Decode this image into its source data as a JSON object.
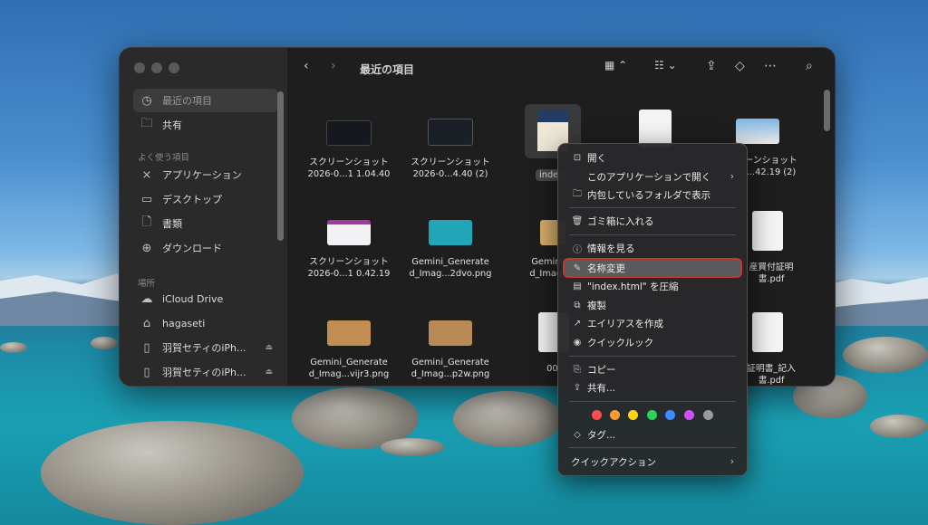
{
  "window": {
    "title": "最近の項目"
  },
  "sidebar": {
    "recents": "最近の項目",
    "shared": "共有",
    "favorites_header": "よく使う項目",
    "favorites": [
      "アプリケーション",
      "デスクトップ",
      "書類",
      "ダウンロード"
    ],
    "locations_header": "場所",
    "locations": [
      "iCloud Drive",
      "hagaseti",
      "羽賀セティのiPh...",
      "羽賀セティのiPh..."
    ]
  },
  "files": [
    {
      "line1": "スクリーンショット",
      "line2": "2026-0...1 1.04.40"
    },
    {
      "line1": "スクリーンショット",
      "line2": "2026-0...4.40 (2)"
    },
    {
      "line1": "index.",
      "line2": ""
    },
    {
      "line1": "",
      "line2": ""
    },
    {
      "line1": "スクリーンショット",
      "line2": "...42.19 (2)"
    },
    {
      "line1": "スクリーンショット",
      "line2": "2026-0...1 0.42.19"
    },
    {
      "line1": "Gemini_Generate",
      "line2": "d_Imag...2dvo.png"
    },
    {
      "line1": "Gemini_G",
      "line2": "d_Imag...2"
    },
    {
      "line1": "",
      "line2": ""
    },
    {
      "line1": "産買付証明",
      "line2": "書.pdf"
    },
    {
      "line1": "Gemini_Generate",
      "line2": "d_Imag...vijr3.png"
    },
    {
      "line1": "Gemini_Generate",
      "line2": "d_Imag...p2w.png"
    },
    {
      "line1": "0014798",
      "line2": ""
    },
    {
      "line1": "",
      "line2": ""
    },
    {
      "line1": "証明書_記入",
      "line2": "書.pdf"
    }
  ],
  "context_menu": {
    "open": "開く",
    "open_with": "このアプリケーションで開く",
    "show_in_folder": "内包しているフォルダで表示",
    "move_to_trash": "ゴミ箱に入れる",
    "get_info": "情報を見る",
    "rename": "名称変更",
    "compress": "\"index.html\" を圧縮",
    "duplicate": "複製",
    "make_alias": "エイリアスを作成",
    "quick_look": "クイックルック",
    "copy": "コピー",
    "share": "共有...",
    "tags": "タグ...",
    "quick_actions": "クイックアクション"
  },
  "tag_colors": [
    "#ff4d4d",
    "#ff9a2e",
    "#ffd60a",
    "#30d158",
    "#3d8bff",
    "#d14fff",
    "#9a9a9a"
  ],
  "icons": {
    "back": "chevron-left-icon",
    "forward": "chevron-right-icon",
    "search": "search-icon",
    "share": "share-icon",
    "tag": "tag-icon",
    "more": "ellipsis-icon"
  }
}
